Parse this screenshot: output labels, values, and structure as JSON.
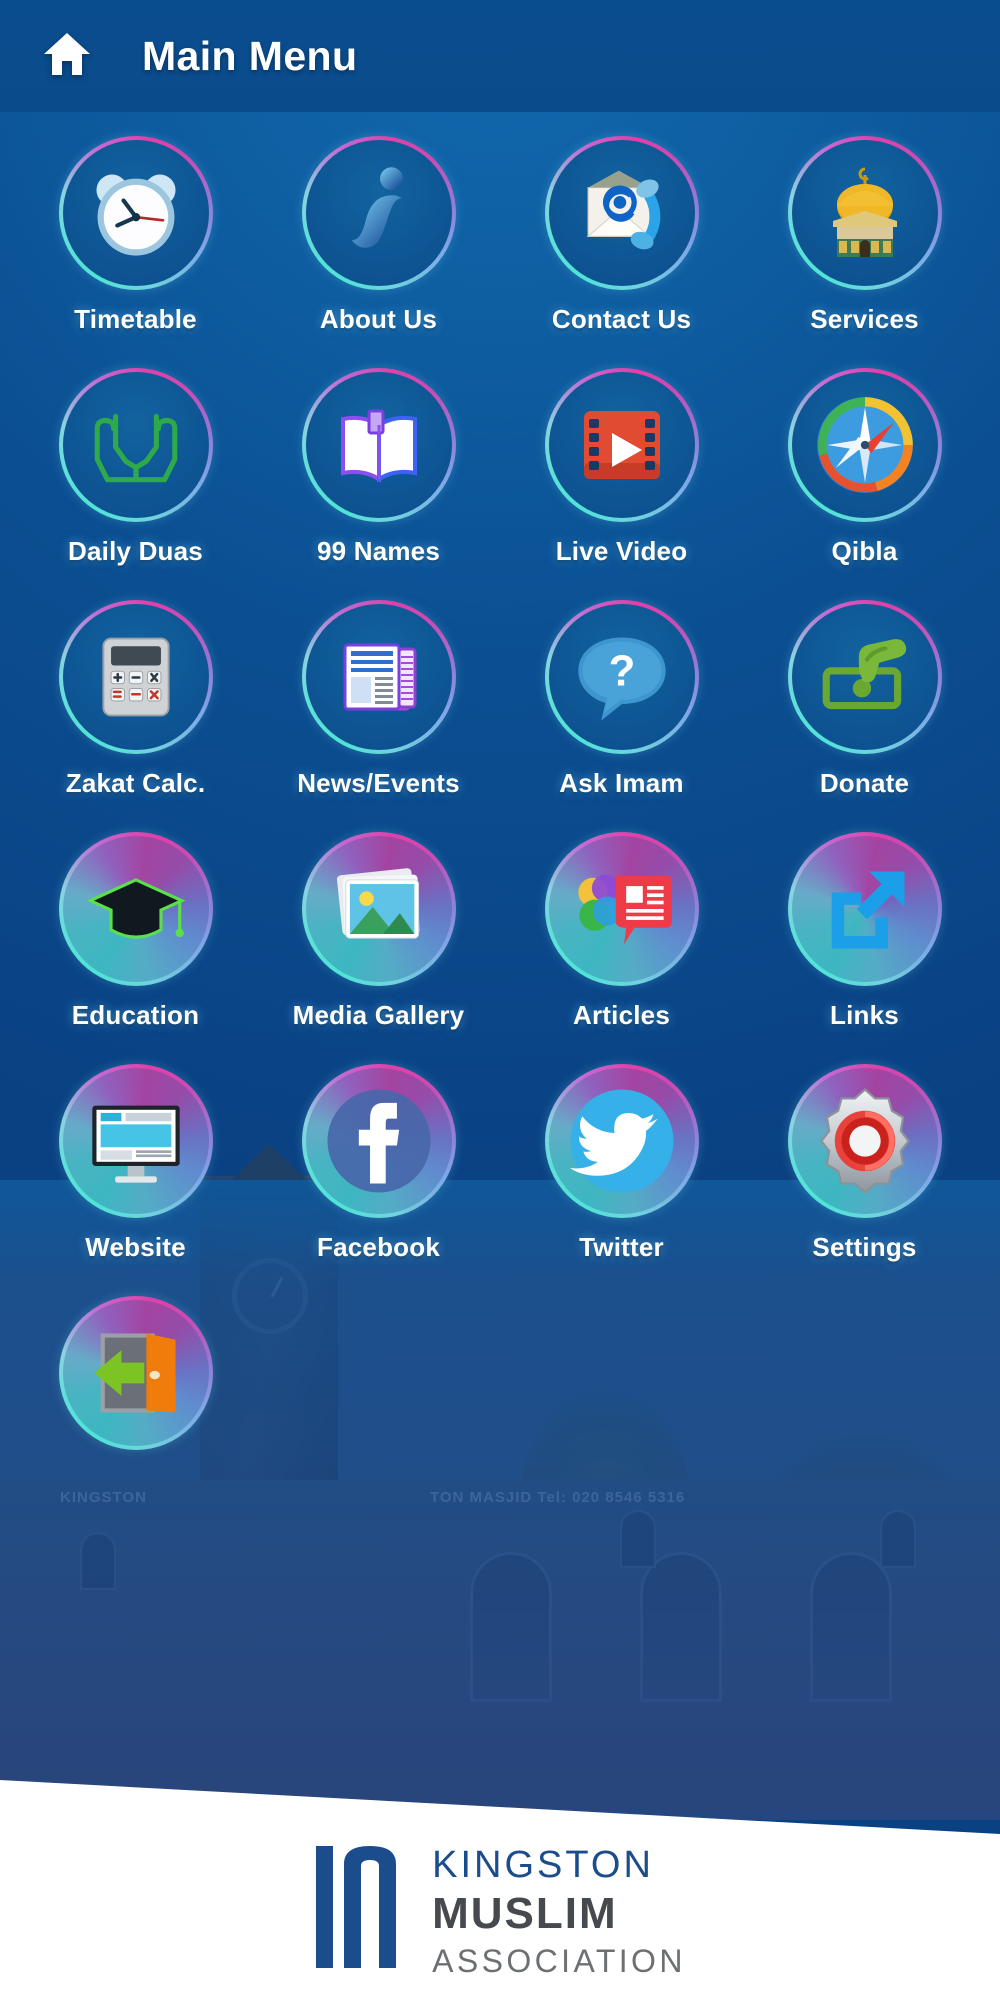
{
  "header": {
    "home_icon": "home-icon",
    "title": "Main Menu"
  },
  "theme": {
    "background_top": "#1169ae",
    "background_bottom": "#0a4183",
    "header_bg": "#0a4d8e",
    "ring_cyan": "#4fe3d6",
    "ring_magenta": "#e040a8",
    "ring_blue": "#7fa8e8",
    "label_color": "#ffffff"
  },
  "menu": {
    "items": [
      {
        "label": "Timetable",
        "icon": "alarm-clock-icon"
      },
      {
        "label": "About Us",
        "icon": "info-i-icon"
      },
      {
        "label": "Contact Us",
        "icon": "envelope-at-phone-icon"
      },
      {
        "label": "Services",
        "icon": "dome-mosque-icon"
      },
      {
        "label": "Daily Duas",
        "icon": "praying-hands-icon"
      },
      {
        "label": "99 Names",
        "icon": "open-book-icon"
      },
      {
        "label": "Live Video",
        "icon": "film-play-icon"
      },
      {
        "label": "Qibla",
        "icon": "compass-icon"
      },
      {
        "label": "Zakat Calc.",
        "icon": "calculator-icon"
      },
      {
        "label": "News/Events",
        "icon": "newspaper-icon"
      },
      {
        "label": "Ask Imam",
        "icon": "question-speech-bubble-icon"
      },
      {
        "label": "Donate",
        "icon": "hand-cash-icon"
      },
      {
        "label": "Education",
        "icon": "graduation-cap-icon"
      },
      {
        "label": "Media Gallery",
        "icon": "photo-stack-icon"
      },
      {
        "label": "Articles",
        "icon": "speech-article-icon"
      },
      {
        "label": "Links",
        "icon": "external-link-arrow-icon"
      },
      {
        "label": "Website",
        "icon": "desktop-monitor-icon"
      },
      {
        "label": "Facebook",
        "icon": "facebook-f-icon"
      },
      {
        "label": "Twitter",
        "icon": "twitter-bird-icon"
      },
      {
        "label": "Settings",
        "icon": "gear-icon"
      },
      {
        "label": "",
        "icon": "exit-door-icon"
      }
    ]
  },
  "background_photo": {
    "sign_text_left": "KINGSTON",
    "sign_text_right": "TON MASJID   Tel: 020 8546 5316"
  },
  "footer": {
    "logo_mark": "archway-mihrab-logo",
    "line1": "KINGSTON",
    "line2": "MUSLIM",
    "line3": "ASSOCIATION"
  }
}
